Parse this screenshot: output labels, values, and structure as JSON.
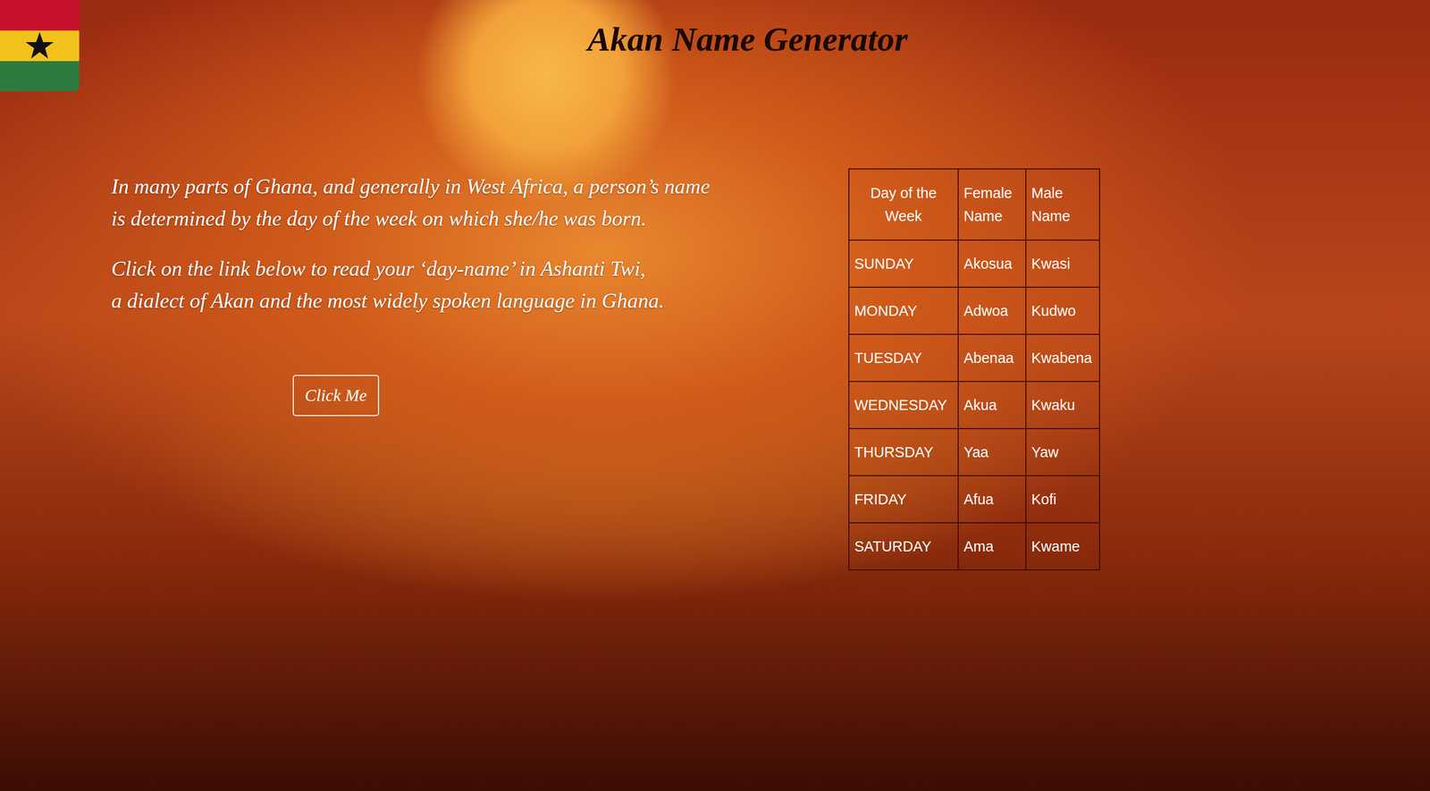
{
  "header": {
    "title": "Akan Name Generator"
  },
  "intro": {
    "paragraphs": [
      [
        "In many parts of Ghana, and generally in West Africa, a person’s name",
        "is determined by the day of the week on which she/he was born."
      ],
      [
        "Click on the link below to read your ‘day-name’ in Ashanti Twi,",
        "a dialect of Akan and the most widely spoken language in Ghana."
      ]
    ]
  },
  "button": {
    "label": "Click Me"
  },
  "table": {
    "columns": [
      "Day of the Week",
      "Female Name",
      "Male Name"
    ],
    "rows": [
      [
        "SUNDAY",
        "Akosua",
        "Kwasi"
      ],
      [
        "MONDAY",
        "Adwoa",
        "Kudwo"
      ],
      [
        "TUESDAY",
        "Abenaa",
        "Kwabena"
      ],
      [
        "WEDNESDAY",
        "Akua",
        "Kwaku"
      ],
      [
        "THURSDAY",
        "Yaa",
        "Yaw"
      ],
      [
        "FRIDAY",
        "Afua",
        "Kofi"
      ],
      [
        "SATURDAY",
        "Ama",
        "Kwame"
      ]
    ]
  }
}
